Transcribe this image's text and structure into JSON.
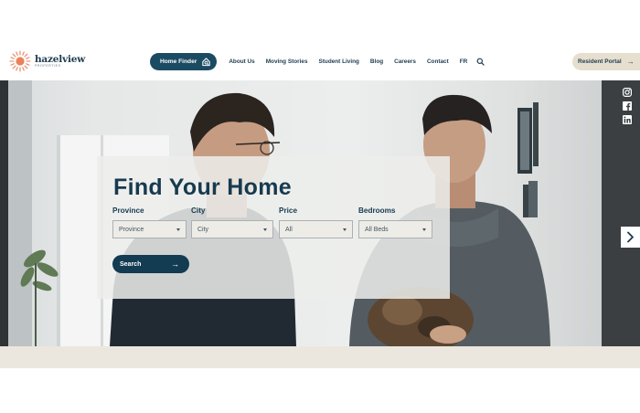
{
  "brand": {
    "name": "hazelview",
    "tagline": "PROPERTIES",
    "colors": {
      "navy": "#173a4f",
      "accent": "#e9825c",
      "beige": "#e6dfcf"
    }
  },
  "nav": {
    "home_finder": "Home Finder",
    "home_finder_icon": "house-search-icon",
    "items": [
      "About Us",
      "Moving Stories",
      "Student Living",
      "Blog",
      "Careers",
      "Contact",
      "FR"
    ],
    "search_icon": "search-icon"
  },
  "resident_portal": {
    "label": "Resident Portal",
    "arrow": "→"
  },
  "social": [
    "instagram-icon",
    "facebook-icon",
    "linkedin-icon"
  ],
  "search_panel": {
    "title": "Find Your Home",
    "fields": [
      {
        "label": "Province",
        "value": "Province"
      },
      {
        "label": "City",
        "value": "City"
      },
      {
        "label": "Price",
        "value": "All"
      },
      {
        "label": "Bedrooms",
        "value": "All Beds"
      }
    ],
    "search_label": "Search",
    "search_arrow": "→"
  },
  "carousel": {
    "next_icon": "chevron-right-icon"
  }
}
